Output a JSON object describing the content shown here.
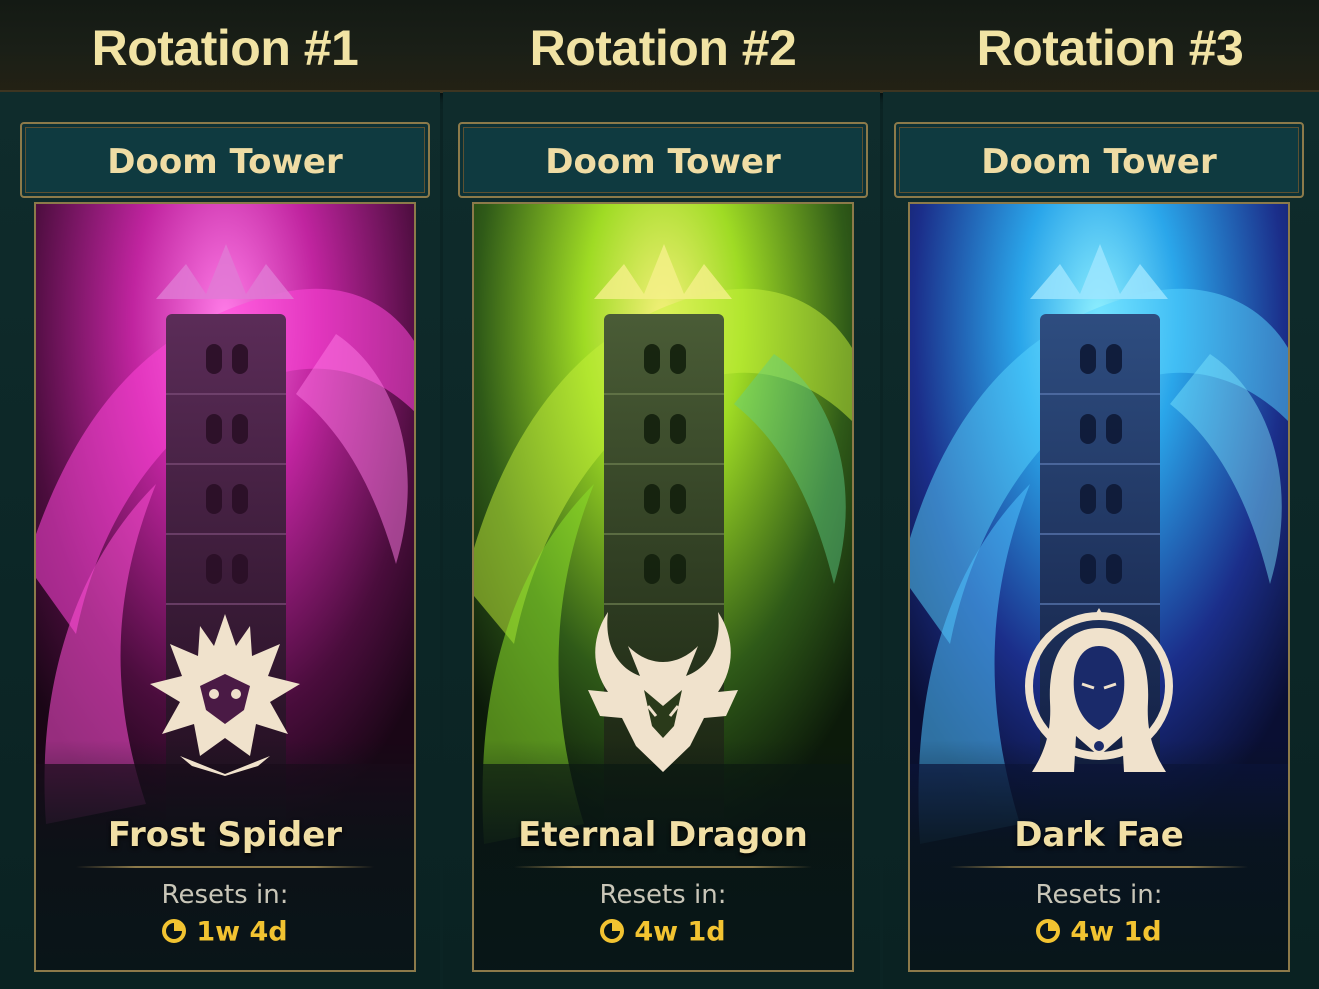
{
  "header": {
    "rotations": [
      "Rotation #1",
      "Rotation #2",
      "Rotation #3"
    ]
  },
  "cards": [
    {
      "header_title": "Doom Tower",
      "boss_name": "Frost Spider",
      "resets_label": "Resets in:",
      "reset_time": "1w 4d",
      "boss_icon": "spider-crest-icon",
      "theme_color": "#d23cc8"
    },
    {
      "header_title": "Doom Tower",
      "boss_name": "Eternal Dragon",
      "resets_label": "Resets in:",
      "reset_time": "4w 1d",
      "boss_icon": "dragon-crest-icon",
      "theme_color": "#a6e02a"
    },
    {
      "header_title": "Doom Tower",
      "boss_name": "Dark Fae",
      "resets_label": "Resets in:",
      "reset_time": "4w 1d",
      "boss_icon": "fae-crest-icon",
      "theme_color": "#2fb4f0"
    }
  ],
  "colors": {
    "title_text": "#f1e3a4",
    "header_panel": "#0f3a40",
    "gold_border": "#8c7a4a",
    "timer_text": "#f2c331"
  }
}
